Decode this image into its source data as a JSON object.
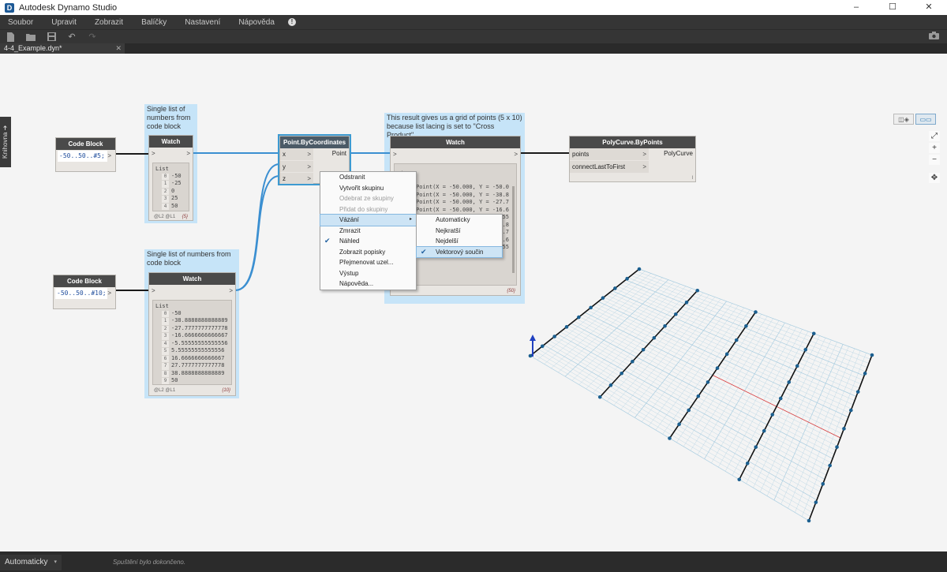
{
  "window": {
    "title": "Autodesk Dynamo Studio",
    "controls": [
      "–",
      "☐",
      "✕"
    ]
  },
  "menu": [
    "Soubor",
    "Upravit",
    "Zobrazit",
    "Balíčky",
    "Nastavení",
    "Nápověda"
  ],
  "toolbar": {
    "icons": [
      "new-file-icon",
      "open-folder-icon",
      "save-icon",
      "undo-icon",
      "redo-icon",
      "camera-icon"
    ]
  },
  "tab": {
    "label": "4-4_Example.dyn*",
    "close": "✕"
  },
  "library_label": "Knihovna ➔",
  "view_toggle": {
    "geometry": "◫◈",
    "graph": "▭▭"
  },
  "zoom": {
    "fit": "⤢",
    "in": "+",
    "out": "−",
    "pan": "✥"
  },
  "groups": {
    "watch1": "Single list of numbers from code block",
    "watch2": "Single list of numbers from code block",
    "watch3": "This result gives us a grid of points (5 x 10) because list lacing is set to \"Cross Product\""
  },
  "nodes": {
    "code_block_1": {
      "title": "Code Block",
      "code": "-50..50..#5;"
    },
    "code_block_2": {
      "title": "Code Block",
      "code": "-50..50..#10;"
    },
    "watch_1": {
      "title": "Watch",
      "list_label": "List",
      "items": [
        "-50",
        "-25",
        "0",
        "25",
        "50"
      ],
      "levels": "@L2 @L1",
      "count": "{5}"
    },
    "watch_2": {
      "title": "Watch",
      "list_label": "List",
      "items": [
        "-50",
        "-38.8888888888889",
        "-27.7777777777778",
        "-16.6666666666667",
        "-5.55555555555556",
        "5.55555555555556",
        "16.6666666666667",
        "27.7777777777778",
        "38.8888888888889",
        "50"
      ],
      "levels": "@L2 @L1",
      "count": "{10}"
    },
    "point_by_coordinates": {
      "title": "Point.ByCoordinates",
      "inputs": [
        "x",
        "y",
        "z"
      ],
      "output": "Point"
    },
    "watch_3": {
      "title": "Watch",
      "list_label": "List",
      "sub_label": "List",
      "items": [
        "Point(X = -50.000, Y = -50.0",
        "Point(X = -50.000, Y = -38.8",
        "Point(X = -50.000, Y = -27.7",
        "Point(X = -50.000, Y = -16.6",
        "Point(X = -50.000, Y = -5.55",
        "Point(X = -25.000, Y = -38.8",
        "Point(X = -25.000, Y = -27.7",
        "Point(X = -25.000, Y = -16.6",
        "Point(X = -25.000, Y = -5.55"
      ],
      "count": "{50}"
    },
    "polycurve_by_points": {
      "title": "PolyCurve.ByPoints",
      "inputs": [
        "points",
        "connectLastToFirst"
      ],
      "output": "PolyCurve",
      "footer": "l"
    }
  },
  "context_menu": {
    "items": [
      {
        "label": "Odstranit",
        "disabled": false,
        "checked": false,
        "submenu": false
      },
      {
        "label": "Vytvořit skupinu",
        "disabled": false,
        "checked": false,
        "submenu": false
      },
      {
        "label": "Odebrat ze skupiny",
        "disabled": true,
        "checked": false,
        "submenu": false
      },
      {
        "label": "Přidat do skupiny",
        "disabled": true,
        "checked": false,
        "submenu": false
      },
      {
        "label": "Vázání",
        "disabled": false,
        "checked": false,
        "submenu": true
      },
      {
        "label": "Zmrazit",
        "disabled": false,
        "checked": false,
        "submenu": false
      },
      {
        "label": "Náhled",
        "disabled": false,
        "checked": true,
        "submenu": false
      },
      {
        "label": "Zobrazit popisky",
        "disabled": false,
        "checked": false,
        "submenu": false
      },
      {
        "label": "Přejmenovat uzel...",
        "disabled": false,
        "checked": false,
        "submenu": false
      },
      {
        "label": "Výstup",
        "disabled": false,
        "checked": false,
        "submenu": false
      },
      {
        "label": "Nápověda...",
        "disabled": false,
        "checked": false,
        "submenu": false
      }
    ],
    "checkmark": "✔",
    "submenu_arrow": "▸"
  },
  "lacing_submenu": {
    "items": [
      {
        "label": "Automaticky",
        "checked": false
      },
      {
        "label": "Nejkratší",
        "checked": false
      },
      {
        "label": "Nejdelší",
        "checked": false
      },
      {
        "label": "Vektorový součin",
        "checked": true
      }
    ]
  },
  "statusbar": {
    "run_mode": "Automaticky",
    "caret": "▾",
    "message": "Spuštění bylo dokončeno."
  },
  "colors": {
    "wire": "#3b8fd1",
    "group_bg": "#c6e4f8",
    "grid_line": "#a9cde0",
    "point": "#1b5f8f",
    "polycurve": "#111111",
    "axis_x": "#e04040",
    "axis_z": "#2040c0"
  }
}
